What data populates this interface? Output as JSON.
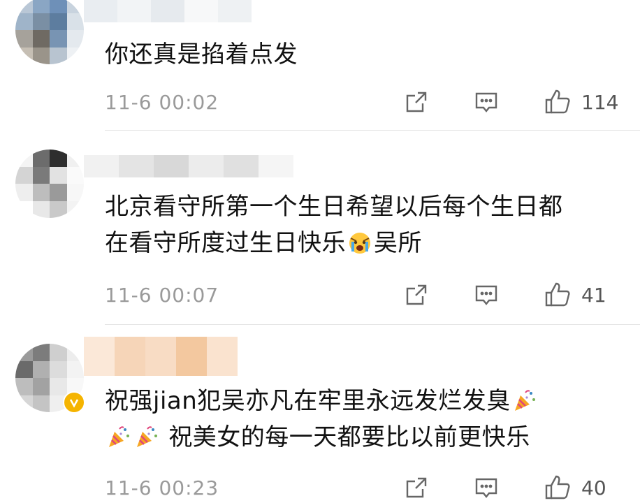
{
  "comments": [
    {
      "text_lines": [
        "你还真是掐着点发"
      ],
      "time": "11-6 00:02",
      "likes": "114"
    },
    {
      "text_lines": [
        "北京看守所第一个生日希望以后每个生日都",
        "在看守所度过生日快乐",
        "吴所"
      ],
      "time": "11-6 00:07",
      "likes": "41"
    },
    {
      "text_lines": [
        "祝强jian犯吴亦凡在牢里永远发烂发臭",
        "祝美女的每一天都要比以前更快乐"
      ],
      "time": "11-6 00:23",
      "likes": "40",
      "verified": true
    }
  ],
  "icons": {
    "share": "share-icon",
    "comment": "comment-icon",
    "like": "thumbs-up-icon",
    "emoji_cry": "crying-face-emoji",
    "emoji_party": "party-popper-emoji"
  },
  "colors": {
    "timestamp": "#9a9a9a",
    "icon": "#666666",
    "verified_badge": "#f5b400"
  }
}
